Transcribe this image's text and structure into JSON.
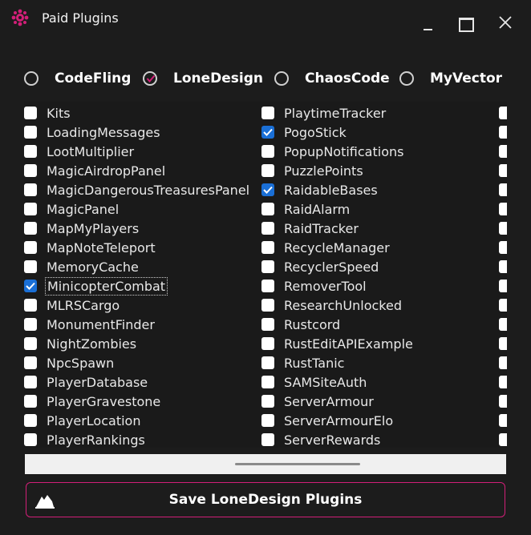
{
  "window": {
    "title": "Paid Plugins",
    "accent_color": "#d21f78",
    "checkbox_checked_color": "#1a6fd6",
    "controls": [
      "minimize-icon",
      "maximize-icon",
      "close-icon"
    ]
  },
  "authors": [
    {
      "label": "CodeFling",
      "checked": false
    },
    {
      "label": "LoneDesign",
      "checked": true
    },
    {
      "label": "ChaosCode",
      "checked": false
    },
    {
      "label": "MyVector",
      "checked": false
    }
  ],
  "plugins": {
    "column1": [
      {
        "label": "Kits",
        "checked": false
      },
      {
        "label": "LoadingMessages",
        "checked": false
      },
      {
        "label": "LootMultiplier",
        "checked": false
      },
      {
        "label": "MagicAirdropPanel",
        "checked": false
      },
      {
        "label": "MagicDangerousTreasuresPanel",
        "checked": false
      },
      {
        "label": "MagicPanel",
        "checked": false
      },
      {
        "label": "MapMyPlayers",
        "checked": false
      },
      {
        "label": "MapNoteTeleport",
        "checked": false
      },
      {
        "label": "MemoryCache",
        "checked": false
      },
      {
        "label": "MinicopterCombat",
        "checked": true,
        "focused": true
      },
      {
        "label": "MLRSCargo",
        "checked": false
      },
      {
        "label": "MonumentFinder",
        "checked": false
      },
      {
        "label": "NightZombies",
        "checked": false
      },
      {
        "label": "NpcSpawn",
        "checked": false
      },
      {
        "label": "PlayerDatabase",
        "checked": false
      },
      {
        "label": "PlayerGravestone",
        "checked": false
      },
      {
        "label": "PlayerLocation",
        "checked": false
      },
      {
        "label": "PlayerRankings",
        "checked": false
      }
    ],
    "column2": [
      {
        "label": "PlaytimeTracker",
        "checked": false
      },
      {
        "label": "PogoStick",
        "checked": true
      },
      {
        "label": "PopupNotifications",
        "checked": false
      },
      {
        "label": "PuzzlePoints",
        "checked": false
      },
      {
        "label": "RaidableBases",
        "checked": true
      },
      {
        "label": "RaidAlarm",
        "checked": false
      },
      {
        "label": "RaidTracker",
        "checked": false
      },
      {
        "label": "RecycleManager",
        "checked": false
      },
      {
        "label": "RecyclerSpeed",
        "checked": false
      },
      {
        "label": "RemoverTool",
        "checked": false
      },
      {
        "label": "ResearchUnlocked",
        "checked": false
      },
      {
        "label": "Rustcord",
        "checked": false
      },
      {
        "label": "RustEditAPIExample",
        "checked": false
      },
      {
        "label": "RustTanic",
        "checked": false
      },
      {
        "label": "SAMSiteAuth",
        "checked": false
      },
      {
        "label": "ServerArmour",
        "checked": false
      },
      {
        "label": "ServerArmourElo",
        "checked": false
      },
      {
        "label": "ServerRewards",
        "checked": false
      }
    ],
    "column3_partial_rows": 18
  },
  "save_button": {
    "label": "Save LoneDesign Plugins",
    "icon": "save-author-icon"
  }
}
